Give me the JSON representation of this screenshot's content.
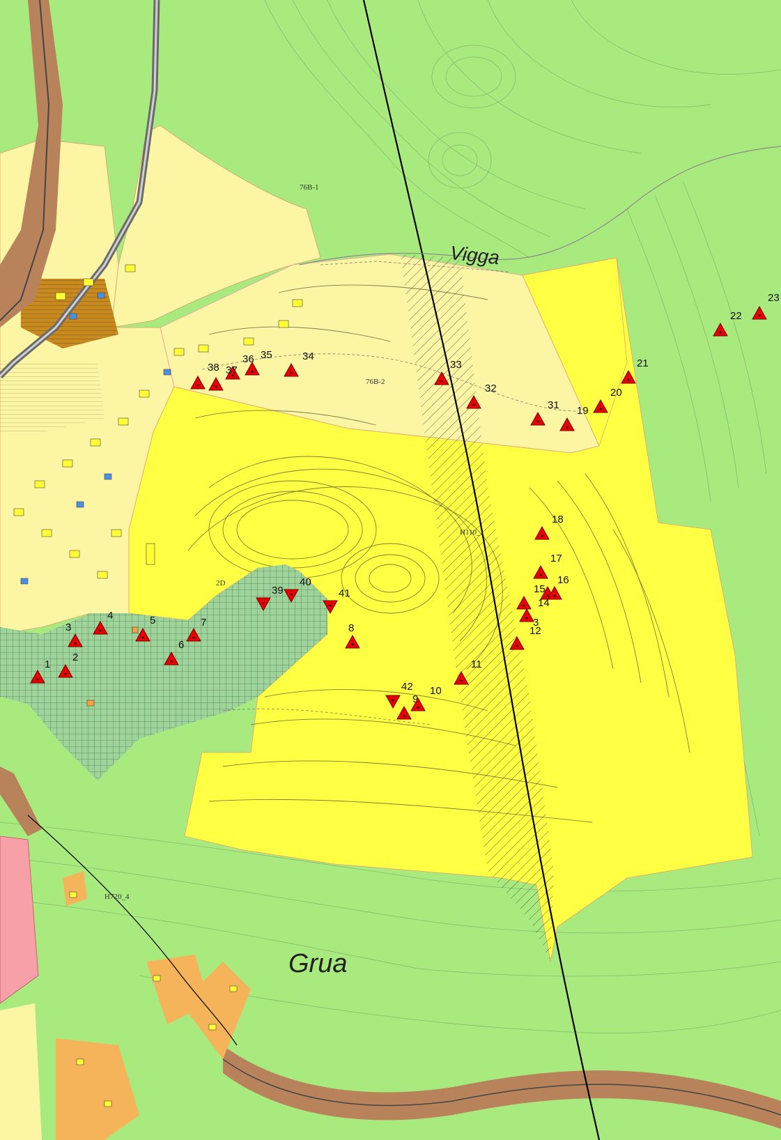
{
  "map": {
    "place_names": {
      "vigga": "Vigga",
      "grua": "Grua"
    },
    "zone_labels": {
      "z76b1": "76B-1",
      "z76b2": "76B-2",
      "zh110": "H110_1",
      "zh720": "H720_4",
      "z2d": "2D"
    },
    "colors": {
      "background_green": "#a9ea7f",
      "light_yellow": "#fbf5a4",
      "bright_yellow": "#ffff44",
      "orange": "#f6b45a",
      "brown": "#b8835a",
      "pink": "#f7a0a8",
      "dark_orange": "#c88a1e",
      "green_grid": "#9ed39a",
      "marker_red": "#e60000"
    },
    "markers": [
      {
        "id": "1",
        "label": "1"
      },
      {
        "id": "2",
        "label": "2"
      },
      {
        "id": "3",
        "label": "3"
      },
      {
        "id": "4",
        "label": "4"
      },
      {
        "id": "5",
        "label": "5"
      },
      {
        "id": "6",
        "label": "6"
      },
      {
        "id": "7",
        "label": "7"
      },
      {
        "id": "8",
        "label": "8"
      },
      {
        "id": "9",
        "label": "9"
      },
      {
        "id": "10",
        "label": "10"
      },
      {
        "id": "11",
        "label": "11"
      },
      {
        "id": "12",
        "label": "12"
      },
      {
        "id": "13",
        "label": "3"
      },
      {
        "id": "14",
        "label": "14"
      },
      {
        "id": "15",
        "label": "15"
      },
      {
        "id": "16",
        "label": "16"
      },
      {
        "id": "17",
        "label": "17"
      },
      {
        "id": "18",
        "label": "18"
      },
      {
        "id": "19",
        "label": "19"
      },
      {
        "id": "20",
        "label": "20"
      },
      {
        "id": "21",
        "label": "21"
      },
      {
        "id": "22",
        "label": "22"
      },
      {
        "id": "23",
        "label": "23"
      },
      {
        "id": "31",
        "label": "31"
      },
      {
        "id": "32",
        "label": "32"
      },
      {
        "id": "33",
        "label": "33"
      },
      {
        "id": "34",
        "label": "34"
      },
      {
        "id": "35",
        "label": "35"
      },
      {
        "id": "36",
        "label": "36"
      },
      {
        "id": "37",
        "label": "37"
      },
      {
        "id": "38",
        "label": "38"
      },
      {
        "id": "39",
        "label": "39"
      },
      {
        "id": "40",
        "label": "40"
      },
      {
        "id": "41",
        "label": "41"
      },
      {
        "id": "42",
        "label": "42"
      }
    ]
  }
}
